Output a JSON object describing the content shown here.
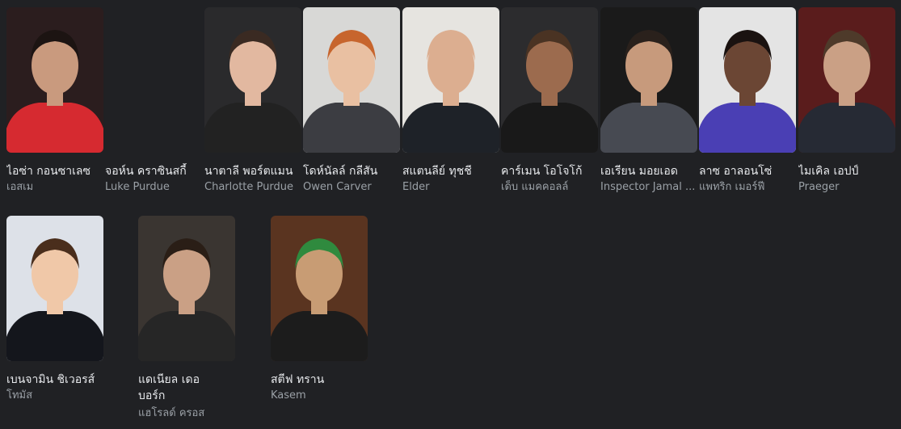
{
  "cast": [
    {
      "name": "ไอซ่า กอนซาเลซ",
      "role": "เอสเม",
      "has_photo": true,
      "bg": "#2b1d1e",
      "skin": "#c99a7e",
      "hair": "#1c1412",
      "shirt": "#d62a30"
    },
    {
      "name": "จอห์น คราซินสกี้",
      "role": "Luke Purdue",
      "has_photo": false
    },
    {
      "name": "นาตาลี พอร์ตแมน",
      "role": "Charlotte Purdue",
      "has_photo": true,
      "bg": "#2a2a2c",
      "skin": "#e2b8a0",
      "hair": "#3a2a22",
      "shirt": "#222222"
    },
    {
      "name": "โดห์นัลล์ กลีสัน",
      "role": "Owen Carver",
      "has_photo": true,
      "bg": "#d8d8d6",
      "skin": "#e9c0a2",
      "hair": "#c7652d",
      "shirt": "#3c3d42"
    },
    {
      "name": "สแตนลีย์ ทุชชี",
      "role": "Elder",
      "has_photo": true,
      "bg": "#e6e4e0",
      "skin": "#dcae90",
      "hair": "#dcae90",
      "shirt": "#1e2228"
    },
    {
      "name": "คาร์เมน โอโจโก้",
      "role": "เด็บ แมคคอลล์",
      "has_photo": true,
      "bg": "#2c2c2e",
      "skin": "#9c6b4e",
      "hair": "#4a3323",
      "shirt": "#191919"
    },
    {
      "name": "เอเรียน มอยเอด",
      "role": "Inspector Jamal ...",
      "has_photo": true,
      "bg": "#1a1a1a",
      "skin": "#c79a7c",
      "hair": "#2a211c",
      "shirt": "#474a52"
    },
    {
      "name": "ลาซ อาลอนโซ่",
      "role": "แพทริก เมอร์ฟี",
      "has_photo": true,
      "bg": "#e4e4e4",
      "skin": "#6b4634",
      "hair": "#1a1210",
      "shirt": "#4a3fb4"
    },
    {
      "name": "ไมเคิล เอปป์",
      "role": "Praeger",
      "has_photo": true,
      "bg": "#5a1c1c",
      "skin": "#caa085",
      "hair": "#4e3a2a",
      "shirt": "#262a34"
    },
    {
      "name": "เบนจามิน ชิเวอรส์",
      "role": "โทมัส",
      "has_photo": true,
      "bg": "#dde1e8",
      "skin": "#f0c8a8",
      "hair": "#4a2e1c",
      "shirt": "#14161c"
    },
    {
      "name": "แดเนียล เดอ บอร์ก",
      "role": "แฮโรลด์ ครอส",
      "has_photo": true,
      "bg": "#3a3531",
      "skin": "#caa085",
      "hair": "#2a1e16",
      "shirt": "#262626"
    },
    {
      "name": "สตีฟ ทราน",
      "role": "Kasem",
      "has_photo": true,
      "bg": "#5a3420",
      "skin": "#c89c74",
      "hair": "#2f8a3e",
      "shirt": "#1c1c1c"
    }
  ]
}
